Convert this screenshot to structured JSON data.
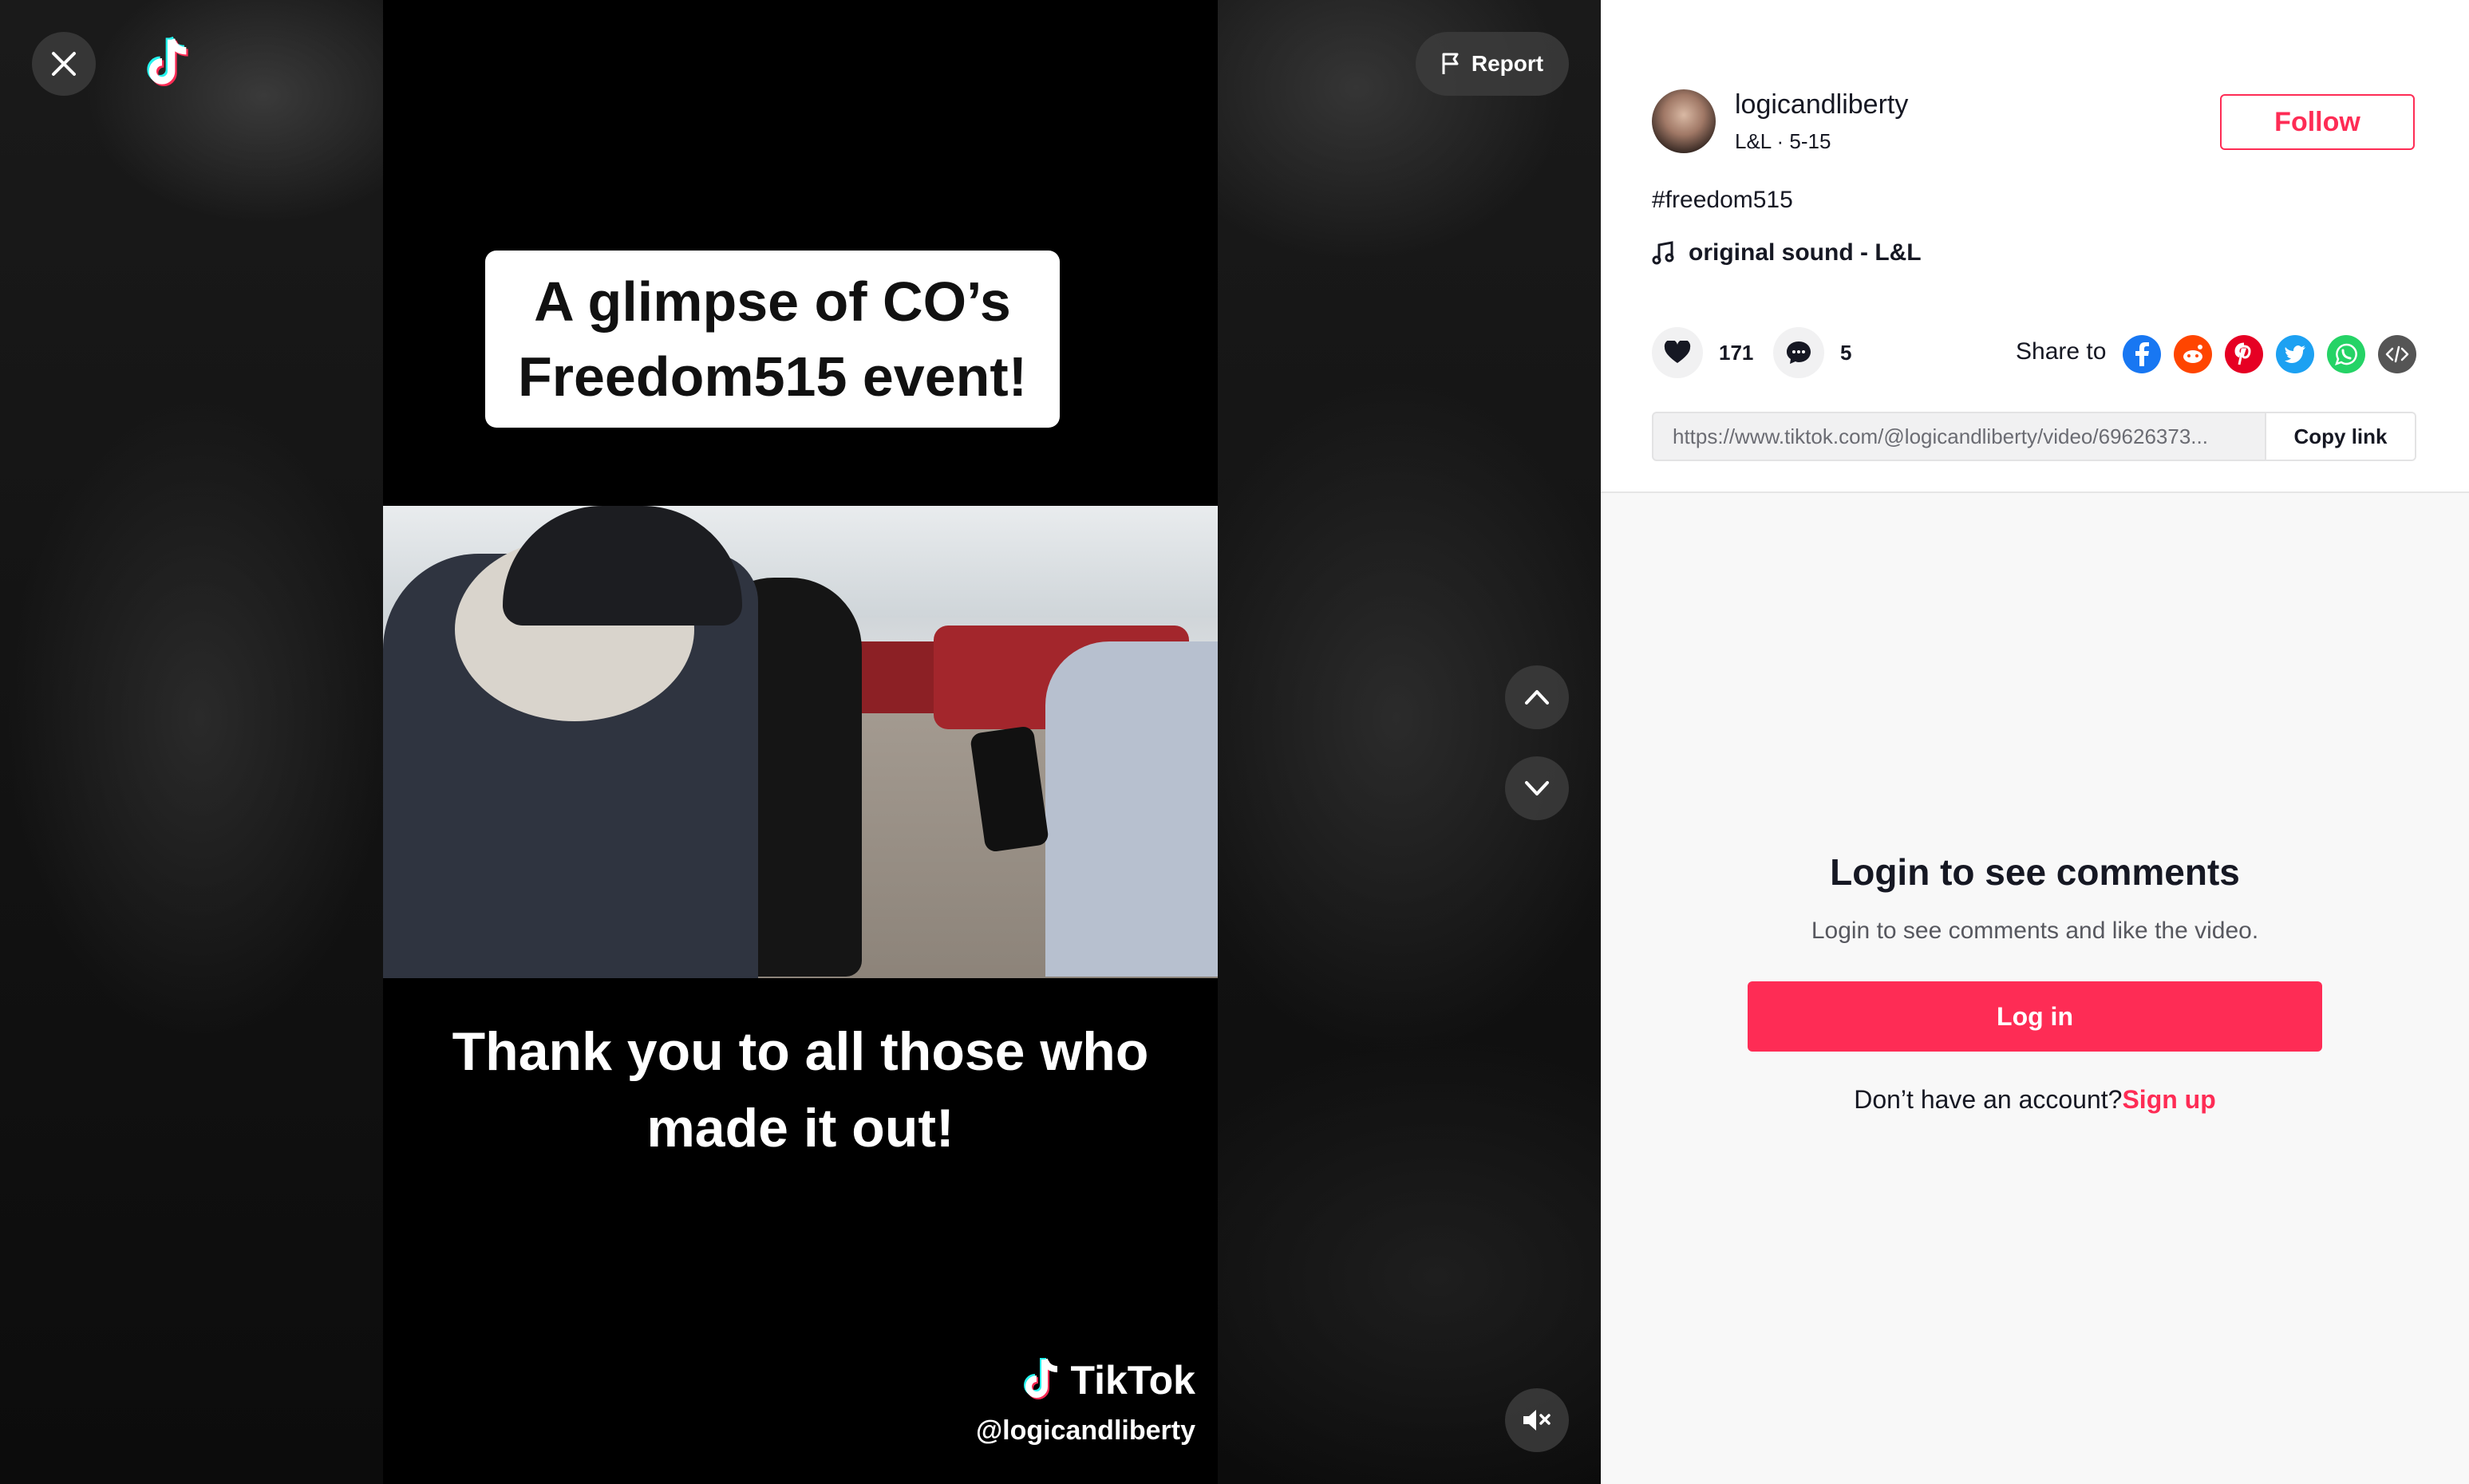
{
  "video": {
    "caption_top": "A glimpse of CO’s Freedom515 event!",
    "caption_bottom": "Thank you to all those who made it out!",
    "watermark_brand": "TikTok",
    "watermark_user": "@logicandliberty",
    "report_label": "Report"
  },
  "post": {
    "username": "logicandliberty",
    "meta": "L&L · 5-15",
    "follow_label": "Follow",
    "hashtag": "#freedom515",
    "sound": "original sound - L&L",
    "likes": "171",
    "comments": "5",
    "share_label": "Share to",
    "share_icons": [
      "facebook-icon",
      "reddit-icon",
      "pinterest-icon",
      "twitter-icon",
      "whatsapp-icon",
      "embed-icon"
    ],
    "link": "https://www.tiktok.com/@logicandliberty/video/69626373...",
    "copy_label": "Copy link"
  },
  "login": {
    "title": "Login to see comments",
    "subtitle": "Login to see comments and like the video.",
    "button": "Log in",
    "no_account": "Don’t have an account?",
    "signup": "Sign up"
  },
  "colors": {
    "accent": "#fe2c55",
    "facebook": "#1877f2",
    "reddit": "#ff4500",
    "pinterest": "#e60023",
    "twitter": "#1da1f2",
    "whatsapp": "#25d366",
    "embed": "#555555"
  }
}
